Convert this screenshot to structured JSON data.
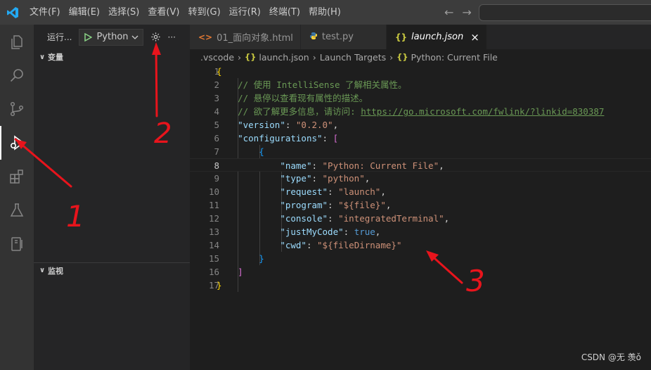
{
  "menu": [
    "文件(F)",
    "编辑(E)",
    "选择(S)",
    "查看(V)",
    "转到(G)",
    "运行(R)",
    "终端(T)",
    "帮助(H)"
  ],
  "sidebar": {
    "run_title": "运行...",
    "run_config": "Python",
    "variables_header": "变量",
    "watch_header": "监视"
  },
  "tabs": [
    {
      "icon": "<>",
      "label": "01_面向对象.html"
    },
    {
      "icon": "py",
      "label": "test.py"
    },
    {
      "icon": "{}",
      "label": "launch.json",
      "close": "×"
    }
  ],
  "breadcrumb": [
    ".vscode",
    "launch.json",
    "Launch Targets",
    "Python: Current File"
  ],
  "editor": {
    "current_line": 8,
    "lines": [
      {
        "n": "1",
        "parts": [
          {
            "t": "{",
            "c": "b1"
          }
        ]
      },
      {
        "n": "2",
        "parts": [
          {
            "t": "    // 使用 IntelliSense 了解相关属性。",
            "c": "comment"
          }
        ]
      },
      {
        "n": "3",
        "parts": [
          {
            "t": "    // 悬停以查看现有属性的描述。",
            "c": "comment"
          }
        ]
      },
      {
        "n": "4",
        "parts": [
          {
            "t": "    // 欲了解更多信息，请访问: ",
            "c": "comment"
          },
          {
            "t": "https://go.microsoft.com/fwlink/?linkid=830387",
            "c": "link"
          }
        ]
      },
      {
        "n": "5",
        "parts": [
          {
            "t": "    ",
            "c": "punct"
          },
          {
            "t": "\"version\"",
            "c": "key"
          },
          {
            "t": ": ",
            "c": "punct"
          },
          {
            "t": "\"0.2.0\"",
            "c": "str"
          },
          {
            "t": ",",
            "c": "punct"
          }
        ]
      },
      {
        "n": "6",
        "parts": [
          {
            "t": "    ",
            "c": "punct"
          },
          {
            "t": "\"configurations\"",
            "c": "key"
          },
          {
            "t": ": ",
            "c": "punct"
          },
          {
            "t": "[",
            "c": "b2"
          }
        ]
      },
      {
        "n": "7",
        "parts": [
          {
            "t": "        ",
            "c": "punct"
          },
          {
            "t": "{",
            "c": "b3"
          }
        ]
      },
      {
        "n": "8",
        "parts": [
          {
            "t": "            ",
            "c": "punct"
          },
          {
            "t": "\"name\"",
            "c": "key"
          },
          {
            "t": ": ",
            "c": "punct"
          },
          {
            "t": "\"Python: Current File\"",
            "c": "str"
          },
          {
            "t": ",",
            "c": "punct"
          }
        ]
      },
      {
        "n": "9",
        "parts": [
          {
            "t": "            ",
            "c": "punct"
          },
          {
            "t": "\"type\"",
            "c": "key"
          },
          {
            "t": ": ",
            "c": "punct"
          },
          {
            "t": "\"python\"",
            "c": "str"
          },
          {
            "t": ",",
            "c": "punct"
          }
        ]
      },
      {
        "n": "10",
        "parts": [
          {
            "t": "            ",
            "c": "punct"
          },
          {
            "t": "\"request\"",
            "c": "key"
          },
          {
            "t": ": ",
            "c": "punct"
          },
          {
            "t": "\"launch\"",
            "c": "str"
          },
          {
            "t": ",",
            "c": "punct"
          }
        ]
      },
      {
        "n": "11",
        "parts": [
          {
            "t": "            ",
            "c": "punct"
          },
          {
            "t": "\"program\"",
            "c": "key"
          },
          {
            "t": ": ",
            "c": "punct"
          },
          {
            "t": "\"${file}\"",
            "c": "str"
          },
          {
            "t": ",",
            "c": "punct"
          }
        ]
      },
      {
        "n": "12",
        "parts": [
          {
            "t": "            ",
            "c": "punct"
          },
          {
            "t": "\"console\"",
            "c": "key"
          },
          {
            "t": ": ",
            "c": "punct"
          },
          {
            "t": "\"integratedTerminal\"",
            "c": "str"
          },
          {
            "t": ",",
            "c": "punct"
          }
        ]
      },
      {
        "n": "13",
        "parts": [
          {
            "t": "            ",
            "c": "punct"
          },
          {
            "t": "\"justMyCode\"",
            "c": "key"
          },
          {
            "t": ": ",
            "c": "punct"
          },
          {
            "t": "true",
            "c": "bool"
          },
          {
            "t": ",",
            "c": "punct"
          }
        ]
      },
      {
        "n": "14",
        "parts": [
          {
            "t": "            ",
            "c": "punct"
          },
          {
            "t": "\"cwd\"",
            "c": "key"
          },
          {
            "t": ": ",
            "c": "punct"
          },
          {
            "t": "\"${fileDirname}\"",
            "c": "str"
          }
        ]
      },
      {
        "n": "15",
        "parts": [
          {
            "t": "        ",
            "c": "punct"
          },
          {
            "t": "}",
            "c": "b3"
          }
        ]
      },
      {
        "n": "16",
        "parts": [
          {
            "t": "    ",
            "c": "punct"
          },
          {
            "t": "]",
            "c": "b2"
          }
        ]
      },
      {
        "n": "17",
        "parts": [
          {
            "t": "}",
            "c": "b1"
          }
        ]
      }
    ]
  },
  "annotations": {
    "one": "1",
    "two": "2",
    "three": "3",
    "color": "#e8141c"
  },
  "watermark": "CSDN @无 羡ǒ",
  "icons": {
    "activity": [
      "files-icon",
      "search-icon",
      "source-control-icon",
      "run-debug-icon",
      "extensions-icon",
      "testing-icon",
      "remote-explorer-icon"
    ]
  }
}
